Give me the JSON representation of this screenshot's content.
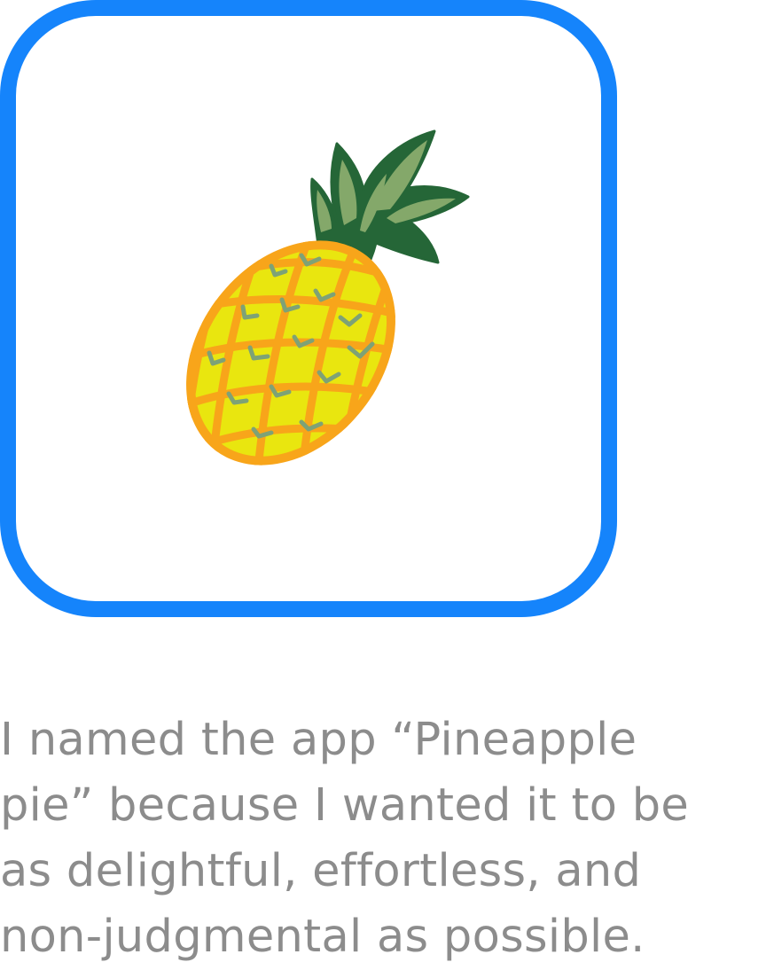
{
  "app_icon": {
    "icon": "pineapple-icon",
    "border_color": "#1584fb"
  },
  "caption": {
    "lines": [
      "I named the app “Pineapple",
      "pie” because I wanted it to be",
      "as delightful, effortless, and",
      "non-judgmental as possible."
    ],
    "color": "#8c8c8c"
  }
}
